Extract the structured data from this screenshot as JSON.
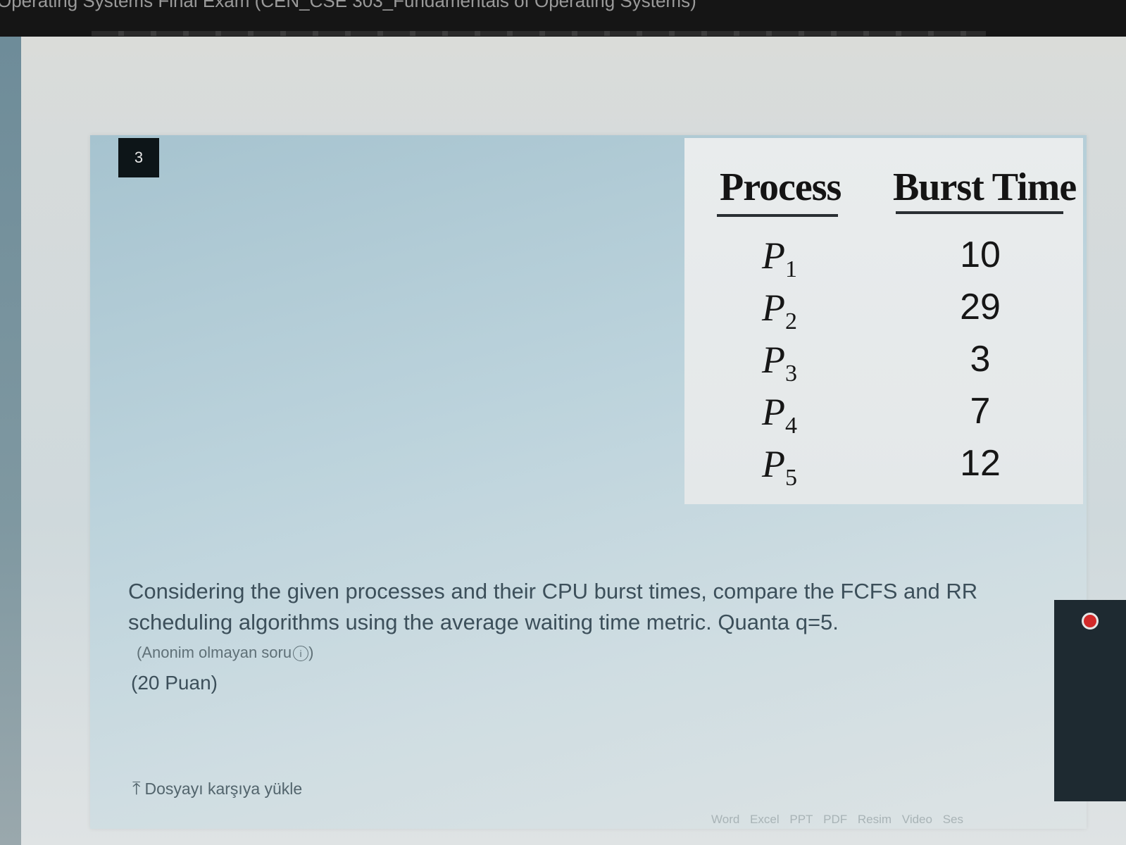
{
  "window": {
    "title": "Operating Systems Final Exam (CEN_CSE 303_Fundamentals of Operating Systems)"
  },
  "question": {
    "number": "3",
    "table": {
      "headers": [
        "Process",
        "Burst Time"
      ],
      "rows": [
        {
          "process_letter": "P",
          "process_sub": "1",
          "burst": "10"
        },
        {
          "process_letter": "P",
          "process_sub": "2",
          "burst": "29"
        },
        {
          "process_letter": "P",
          "process_sub": "3",
          "burst": "3"
        },
        {
          "process_letter": "P",
          "process_sub": "4",
          "burst": "7"
        },
        {
          "process_letter": "P",
          "process_sub": "5",
          "burst": "12"
        }
      ]
    },
    "text": "Considering the given processes and their CPU burst times, compare the FCFS and RR scheduling algorithms using the average waiting time metric. Quanta q=5.",
    "anon_note": "(Anonim olmayan soru",
    "anon_note_close": ")",
    "info_icon_glyph": "i",
    "points": "(20 Puan)"
  },
  "upload": {
    "label": "Dosyayı karşıya yükle",
    "icon": "upload-arrow-icon",
    "icon_glyph": "⤒",
    "file_types": [
      "Word",
      "Excel",
      "PPT",
      "PDF",
      "Resim",
      "Video",
      "Ses"
    ]
  },
  "colors": {
    "record_button": "#d22a2a",
    "question_text": "#3c4f5a"
  }
}
